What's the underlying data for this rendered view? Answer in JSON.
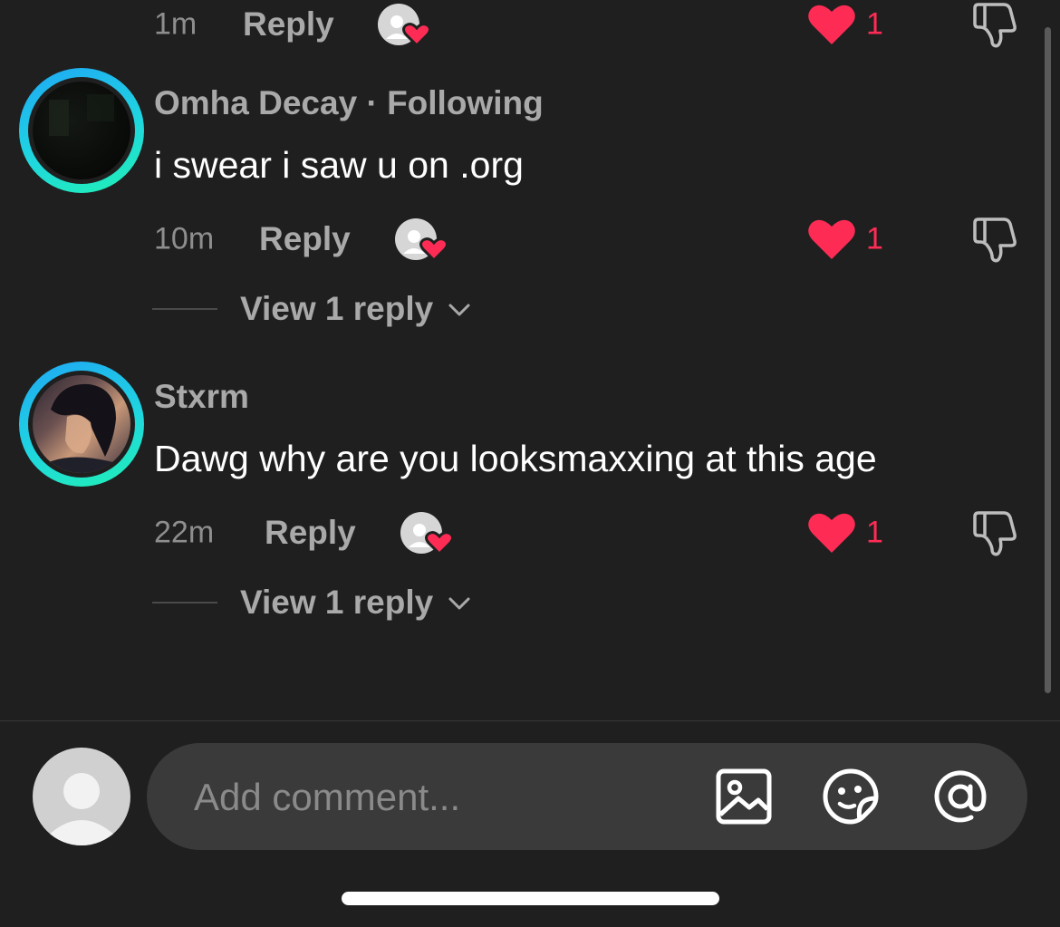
{
  "top_row": {
    "time": "1m",
    "reply_label": "Reply",
    "like_count": "1"
  },
  "comments": [
    {
      "username": "Omha Decay",
      "separator": " · ",
      "follow_status": "Following",
      "text": "i swear i saw u on .org",
      "time": "10m",
      "reply_label": "Reply",
      "like_count": "1",
      "view_replies": "View 1 reply"
    },
    {
      "username": "Stxrm",
      "text": "Dawg why are you looksmaxxing at this age",
      "time": "22m",
      "reply_label": "Reply",
      "like_count": "1",
      "view_replies": "View 1 reply"
    }
  ],
  "composer": {
    "placeholder": "Add comment..."
  },
  "icons": {
    "like": "heart-icon",
    "creator_like": "creator-liked-icon",
    "dislike": "thumbs-down-icon",
    "chevron": "chevron-down-icon",
    "image": "image-icon",
    "emoji": "emoji-sticker-icon",
    "mention": "at-icon"
  },
  "colors": {
    "background": "#1f1f1f",
    "like": "#fe2c55",
    "secondary_text": "#a9a9a9",
    "ring_start": "#1fa7f5",
    "ring_end": "#21f0b4"
  }
}
